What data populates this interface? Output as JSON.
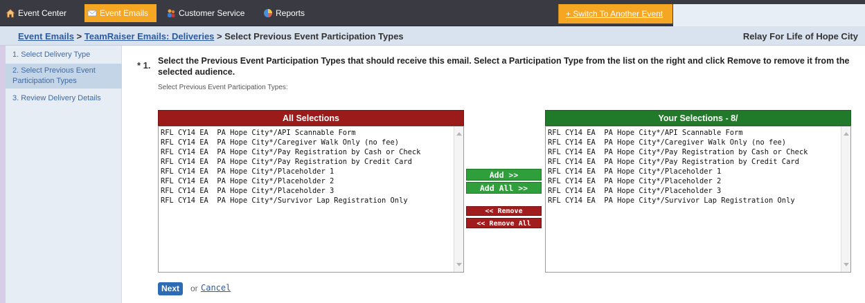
{
  "nav": {
    "items": [
      {
        "label": "Event Center",
        "icon": "house-icon"
      },
      {
        "label": "Event Emails",
        "icon": "envelope-icon",
        "active": true
      },
      {
        "label": "Customer Service",
        "icon": "people-icon"
      },
      {
        "label": "Reports",
        "icon": "chart-icon"
      }
    ],
    "switch_event": "+ Switch To Another Event"
  },
  "breadcrumb": {
    "part1": "Event Emails",
    "sep1": " > ",
    "part2": "TeamRaiser Emails: Deliveries",
    "sep2": " > ",
    "current": "Select Previous Event Participation Types"
  },
  "event_name": "Relay For Life of Hope City",
  "steps": [
    {
      "label": "1.  Select Delivery Type"
    },
    {
      "label": "2.  Select Previous Event Participation Types",
      "active": true
    },
    {
      "label": "3.  Review Delivery Details"
    }
  ],
  "question": {
    "marker": "* 1.",
    "text": "Select the Previous Event Participation Types that should receive this email. Select a Participation Type from the list on the right and click Remove to remove it from the selected audience.",
    "sublabel": "Select Previous Event Participation Types:"
  },
  "all_selections": {
    "header": "All Selections",
    "items": [
      "RFL CY14 EA  PA Hope City*/API Scannable Form",
      "RFL CY14 EA  PA Hope City*/Caregiver Walk Only (no fee)",
      "RFL CY14 EA  PA Hope City*/Pay Registration by Cash or Check",
      "RFL CY14 EA  PA Hope City*/Pay Registration by Credit Card",
      "RFL CY14 EA  PA Hope City*/Placeholder 1",
      "RFL CY14 EA  PA Hope City*/Placeholder 2",
      "RFL CY14 EA  PA Hope City*/Placeholder 3",
      "RFL CY14 EA  PA Hope City*/Survivor Lap Registration Only"
    ]
  },
  "your_selections": {
    "header": "Your Selections - 8/",
    "items": [
      "RFL CY14 EA  PA Hope City*/API Scannable Form",
      "RFL CY14 EA  PA Hope City*/Caregiver Walk Only (no fee)",
      "RFL CY14 EA  PA Hope City*/Pay Registration by Cash or Check",
      "RFL CY14 EA  PA Hope City*/Pay Registration by Credit Card",
      "RFL CY14 EA  PA Hope City*/Placeholder 1",
      "RFL CY14 EA  PA Hope City*/Placeholder 2",
      "RFL CY14 EA  PA Hope City*/Placeholder 3",
      "RFL CY14 EA  PA Hope City*/Survivor Lap Registration Only"
    ]
  },
  "buttons": {
    "add": "Add >>",
    "add_all": "Add All >>",
    "remove": "<< Remove",
    "remove_all": "<< Remove All",
    "next": "Next",
    "or": "or",
    "cancel": "Cancel"
  },
  "colors": {
    "nav_bg": "#3a3a42",
    "accent_orange": "#f5a623",
    "all_header": "#9b1b1b",
    "your_header": "#217a2a",
    "link_blue": "#2c5aa0"
  }
}
